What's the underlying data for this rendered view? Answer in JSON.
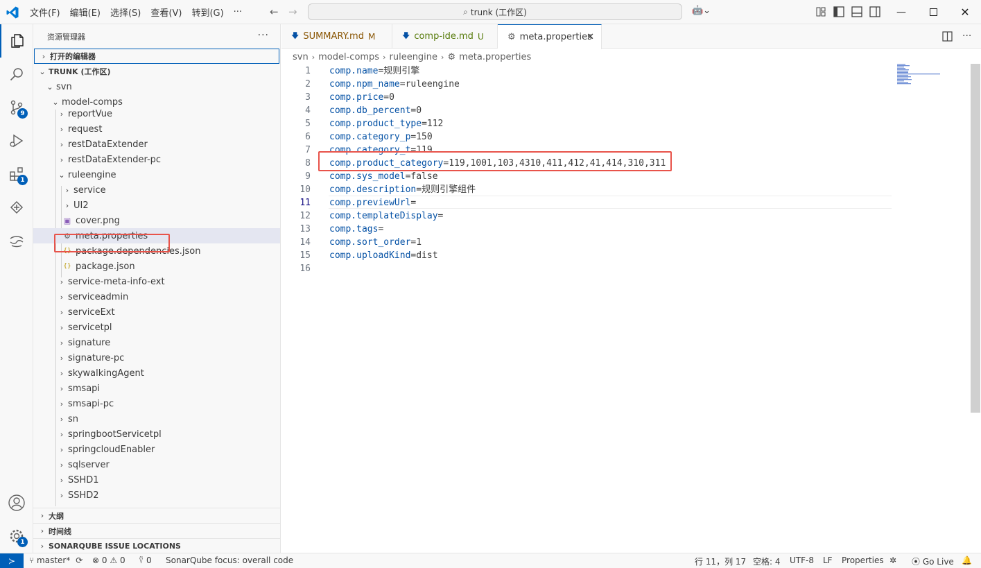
{
  "titlebar": {
    "menu": [
      "文件(F)",
      "编辑(E)",
      "选择(S)",
      "查看(V)",
      "转到(G)",
      "···"
    ],
    "search_text": "trunk (工作区)"
  },
  "activitybar": {
    "badges": {
      "scm": "9",
      "extensions": "1",
      "settings": "1"
    }
  },
  "sidebar": {
    "title": "资源管理器",
    "more": "···",
    "open_editors": "打开的编辑器",
    "workspace": "TRUNK (工作区)",
    "svn": "svn",
    "model_comps": "model-comps",
    "tree": [
      {
        "label": "reportVue",
        "type": "folder",
        "depth": 1
      },
      {
        "label": "request",
        "type": "folder",
        "depth": 1
      },
      {
        "label": "restDataExtender",
        "type": "folder",
        "depth": 1
      },
      {
        "label": "restDataExtender-pc",
        "type": "folder",
        "depth": 1
      },
      {
        "label": "ruleengine",
        "type": "folder-open",
        "depth": 1
      },
      {
        "label": "service",
        "type": "folder",
        "depth": 2
      },
      {
        "label": "UI2",
        "type": "folder",
        "depth": 2
      },
      {
        "label": "cover.png",
        "type": "image",
        "depth": 2
      },
      {
        "label": "meta.properties",
        "type": "settings",
        "depth": 2,
        "selected": true
      },
      {
        "label": "package.dependencies.json",
        "type": "json",
        "depth": 2
      },
      {
        "label": "package.json",
        "type": "json",
        "depth": 2
      },
      {
        "label": "service-meta-info-ext",
        "type": "folder",
        "depth": 1
      },
      {
        "label": "serviceadmin",
        "type": "folder",
        "depth": 1
      },
      {
        "label": "serviceExt",
        "type": "folder",
        "depth": 1
      },
      {
        "label": "servicetpl",
        "type": "folder",
        "depth": 1
      },
      {
        "label": "signature",
        "type": "folder",
        "depth": 1
      },
      {
        "label": "signature-pc",
        "type": "folder",
        "depth": 1
      },
      {
        "label": "skywalkingAgent",
        "type": "folder",
        "depth": 1
      },
      {
        "label": "smsapi",
        "type": "folder",
        "depth": 1
      },
      {
        "label": "smsapi-pc",
        "type": "folder",
        "depth": 1
      },
      {
        "label": "sn",
        "type": "folder",
        "depth": 1
      },
      {
        "label": "springbootServicetpl",
        "type": "folder",
        "depth": 1
      },
      {
        "label": "springcloudEnabler",
        "type": "folder",
        "depth": 1
      },
      {
        "label": "sqlserver",
        "type": "folder",
        "depth": 1
      },
      {
        "label": "SSHD1",
        "type": "folder",
        "depth": 1
      },
      {
        "label": "SSHD2",
        "type": "folder",
        "depth": 1
      }
    ],
    "outline": "大纲",
    "timeline": "时间线",
    "sonar": "SONARQUBE ISSUE LOCATIONS"
  },
  "tabs": [
    {
      "label": "SUMMARY.md",
      "status": "M",
      "status_color": "#895503",
      "label_color": "#895503"
    },
    {
      "label": "comp-ide.md",
      "status": "U",
      "status_color": "#587c0c",
      "label_color": "#587c0c"
    },
    {
      "label": "meta.properties",
      "status": "",
      "active": true
    }
  ],
  "breadcrumb": [
    "svn",
    "model-comps",
    "ruleengine",
    "meta.properties"
  ],
  "editor": {
    "current_line": 11,
    "lines": [
      {
        "n": "1",
        "key": "comp.name",
        "val": "规则引擎"
      },
      {
        "n": "2",
        "key": "comp.npm_name",
        "val": "ruleengine"
      },
      {
        "n": "3",
        "key": "comp.price",
        "val": "0"
      },
      {
        "n": "4",
        "key": "comp.db_percent",
        "val": "0"
      },
      {
        "n": "5",
        "key": "comp.product_type",
        "val": "112"
      },
      {
        "n": "6",
        "key": "comp.category_p",
        "val": "150"
      },
      {
        "n": "7",
        "key": "comp.category_t",
        "val": "119"
      },
      {
        "n": "8",
        "key": "comp.product_category",
        "val": "119,1001,103,4310,411,412,41,414,310,311"
      },
      {
        "n": "9",
        "key": "comp.sys_model",
        "val": "false"
      },
      {
        "n": "10",
        "key": "comp.description",
        "val": "规则引擎组件"
      },
      {
        "n": "11",
        "key": "comp.previewUrl",
        "val": ""
      },
      {
        "n": "12",
        "key": "comp.templateDisplay",
        "val": ""
      },
      {
        "n": "13",
        "key": "comp.tags",
        "val": ""
      },
      {
        "n": "14",
        "key": "comp.sort_order",
        "val": "1"
      },
      {
        "n": "15",
        "key": "comp.uploadKind",
        "val": "dist"
      },
      {
        "n": "16",
        "key": "",
        "val": ""
      }
    ]
  },
  "statusbar": {
    "branch": "master*",
    "errors": "0",
    "warnings": "0",
    "ports": "0",
    "sonar": "SonarQube focus: overall code",
    "position": "行 11，列 17",
    "spaces": "空格: 4",
    "encoding": "UTF-8",
    "eol": "LF",
    "language": "Properties",
    "golive": "Go Live"
  },
  "colors": {
    "accent": "#005fb8",
    "highlight_box": "#e8534a",
    "key": "#0451a5"
  }
}
